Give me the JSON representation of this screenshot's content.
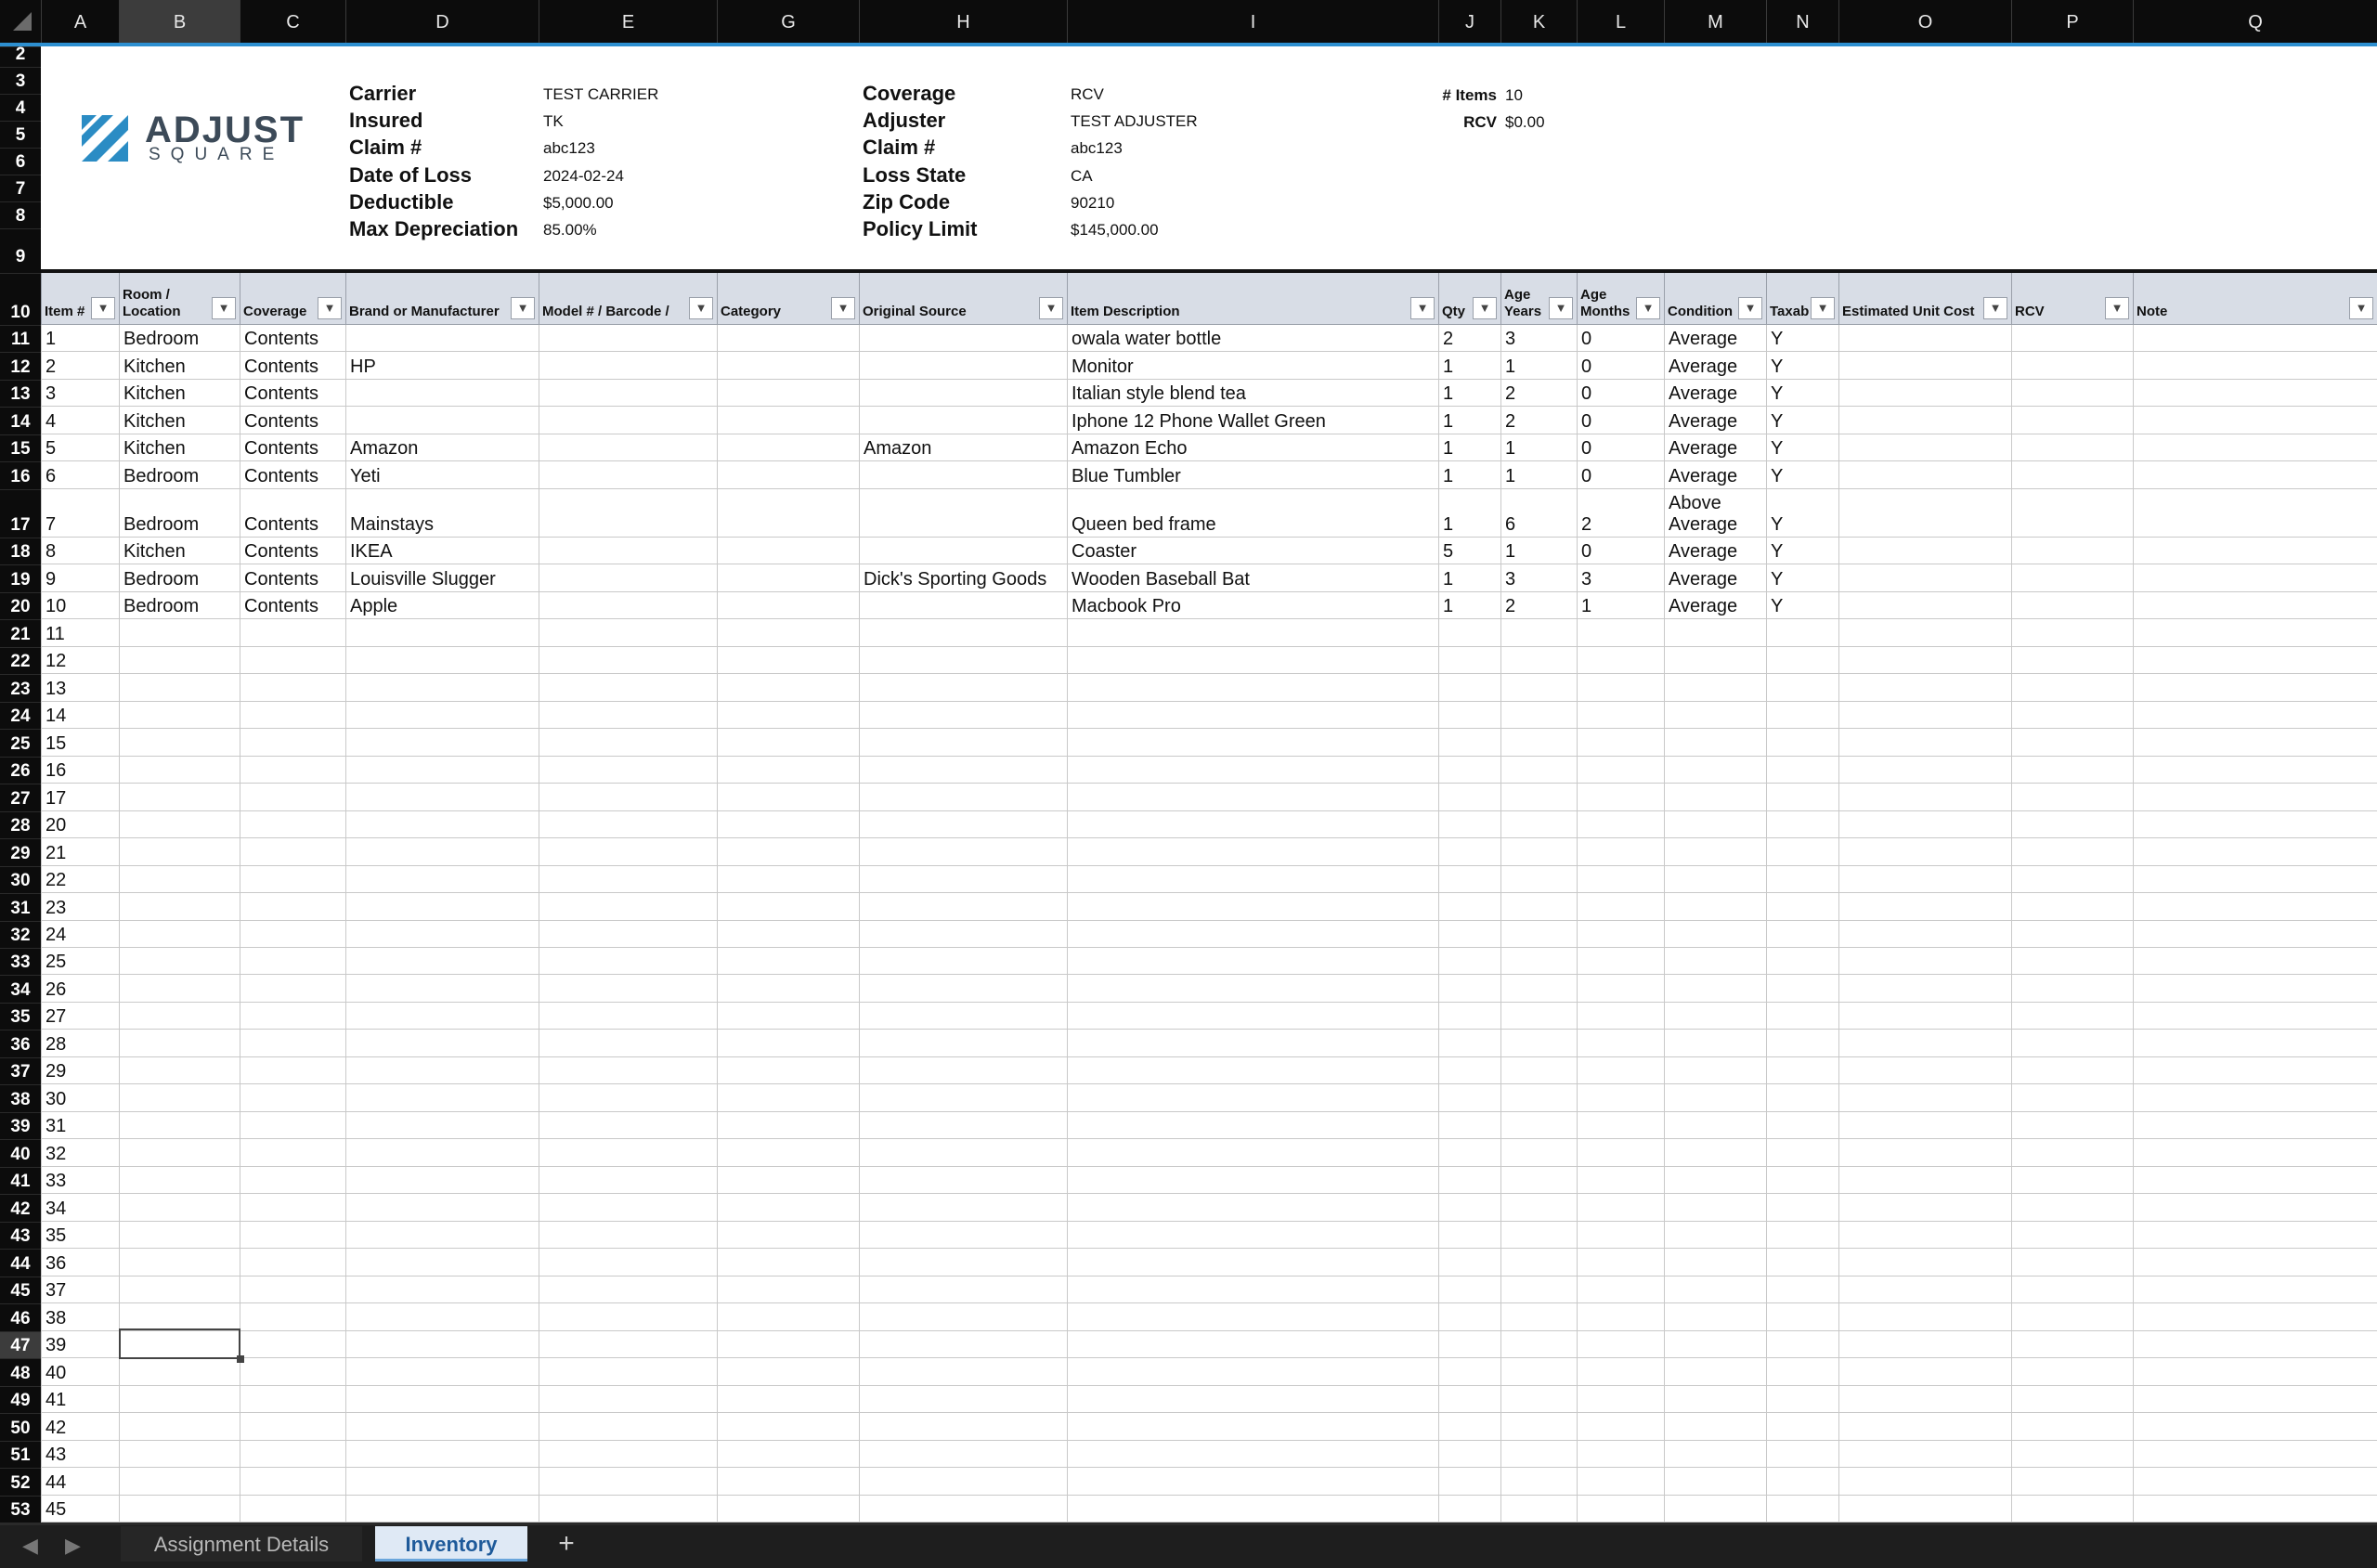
{
  "columns": [
    "A",
    "B",
    "C",
    "D",
    "E",
    "G",
    "H",
    "I",
    "J",
    "K",
    "L",
    "M",
    "N",
    "O",
    "P",
    "Q"
  ],
  "row_numbers": [
    "2",
    "3",
    "4",
    "5",
    "6",
    "7",
    "8",
    "9",
    "10",
    "11",
    "12",
    "13",
    "14",
    "15",
    "16",
    "17",
    "18",
    "19",
    "20",
    "21",
    "22",
    "23",
    "24",
    "25",
    "26",
    "27",
    "28",
    "29",
    "30",
    "31",
    "32",
    "33",
    "34",
    "35",
    "36",
    "37",
    "38",
    "39",
    "40",
    "41",
    "42",
    "43",
    "44",
    "45",
    "46",
    "47",
    "48",
    "49",
    "50",
    "51",
    "52",
    "53"
  ],
  "logo": {
    "line1": "ADJUST",
    "line2": "SQUARE",
    "color": "#2b8cc4"
  },
  "claim_info": {
    "left_labels": [
      "Carrier",
      "Insured",
      "Claim #",
      "Date of Loss",
      "Deductible",
      "Max Depreciation"
    ],
    "left_values": [
      "TEST CARRIER",
      "TK",
      "abc123",
      "2024-02-24",
      "$5,000.00",
      "85.00%"
    ],
    "right_labels": [
      "Coverage",
      "Adjuster",
      "Claim #",
      "Loss State",
      "Zip Code",
      "Policy Limit"
    ],
    "right_values": [
      "RCV",
      "TEST ADJUSTER",
      "abc123",
      "CA",
      "90210",
      "$145,000.00"
    ],
    "summary_labels": [
      "# Items",
      "RCV"
    ],
    "summary_values": [
      "10",
      "$0.00"
    ]
  },
  "table_headers": [
    "Item #",
    "Room /\nLocation",
    "Coverage",
    "Brand or Manufacturer",
    "Model # / Barcode /",
    "Category",
    "Original Source",
    "Item Description",
    "Qty",
    "Age\nYears",
    "Age\nMonths",
    "Condition",
    "Taxab",
    "Estimated Unit Cost",
    "RCV",
    "Note"
  ],
  "rows": [
    {
      "item": "1",
      "room": "Bedroom",
      "coverage": "Contents",
      "brand": "",
      "model": "",
      "category": "",
      "source": "",
      "desc": "owala water bottle",
      "qty": "2",
      "age_years": "3",
      "age_months": "0",
      "condition": "Average",
      "taxable": "Y"
    },
    {
      "item": "2",
      "room": "Kitchen",
      "coverage": "Contents",
      "brand": "HP",
      "model": "",
      "category": "",
      "source": "",
      "desc": "Monitor",
      "qty": "1",
      "age_years": "1",
      "age_months": "0",
      "condition": "Average",
      "taxable": "Y"
    },
    {
      "item": "3",
      "room": "Kitchen",
      "coverage": "Contents",
      "brand": "",
      "model": "",
      "category": "",
      "source": "",
      "desc": "Italian style blend tea",
      "qty": "1",
      "age_years": "2",
      "age_months": "0",
      "condition": "Average",
      "taxable": "Y"
    },
    {
      "item": "4",
      "room": "Kitchen",
      "coverage": "Contents",
      "brand": "",
      "model": "",
      "category": "",
      "source": "",
      "desc": "Iphone 12 Phone Wallet Green",
      "qty": "1",
      "age_years": "2",
      "age_months": "0",
      "condition": "Average",
      "taxable": "Y"
    },
    {
      "item": "5",
      "room": "Kitchen",
      "coverage": "Contents",
      "brand": "Amazon",
      "model": "",
      "category": "",
      "source": "Amazon",
      "desc": "Amazon Echo",
      "qty": "1",
      "age_years": "1",
      "age_months": "0",
      "condition": "Average",
      "taxable": "Y"
    },
    {
      "item": "6",
      "room": "Bedroom",
      "coverage": "Contents",
      "brand": "Yeti",
      "model": "",
      "category": "",
      "source": "",
      "desc": "Blue Tumbler",
      "qty": "1",
      "age_years": "1",
      "age_months": "0",
      "condition": "Average",
      "taxable": "Y"
    },
    {
      "item": "7",
      "room": "Bedroom",
      "coverage": "Contents",
      "brand": "Mainstays",
      "model": "",
      "category": "",
      "source": "",
      "desc": "Queen bed frame",
      "qty": "1",
      "age_years": "6",
      "age_months": "2",
      "condition": "Above\nAverage",
      "taxable": "Y"
    },
    {
      "item": "8",
      "room": "Kitchen",
      "coverage": "Contents",
      "brand": "IKEA",
      "model": "",
      "category": "",
      "source": "",
      "desc": "Coaster",
      "qty": "5",
      "age_years": "1",
      "age_months": "0",
      "condition": "Average",
      "taxable": "Y"
    },
    {
      "item": "9",
      "room": "Bedroom",
      "coverage": "Contents",
      "brand": "Louisville Slugger",
      "model": "",
      "category": "",
      "source": "Dick's Sporting Goods",
      "desc": "Wooden Baseball Bat",
      "qty": "1",
      "age_years": "3",
      "age_months": "3",
      "condition": "Average",
      "taxable": "Y"
    },
    {
      "item": "10",
      "room": "Bedroom",
      "coverage": "Contents",
      "brand": "Apple",
      "model": "",
      "category": "",
      "source": "",
      "desc": "Macbook Pro",
      "qty": "1",
      "age_years": "2",
      "age_months": "1",
      "condition": "Average",
      "taxable": "Y"
    }
  ],
  "empty_item_numbers": [
    "11",
    "12",
    "13",
    "14",
    "15",
    "16",
    "17",
    "20",
    "21",
    "22",
    "23",
    "24",
    "25",
    "26",
    "27",
    "28",
    "29",
    "30",
    "31",
    "32",
    "33",
    "34",
    "35",
    "36",
    "37",
    "38",
    "39",
    "40",
    "41",
    "42",
    "43",
    "44",
    "45"
  ],
  "sheet_tabs": [
    "Assignment Details",
    "Inventory"
  ],
  "active_tab": "Inventory",
  "add_sheet_label": "+"
}
